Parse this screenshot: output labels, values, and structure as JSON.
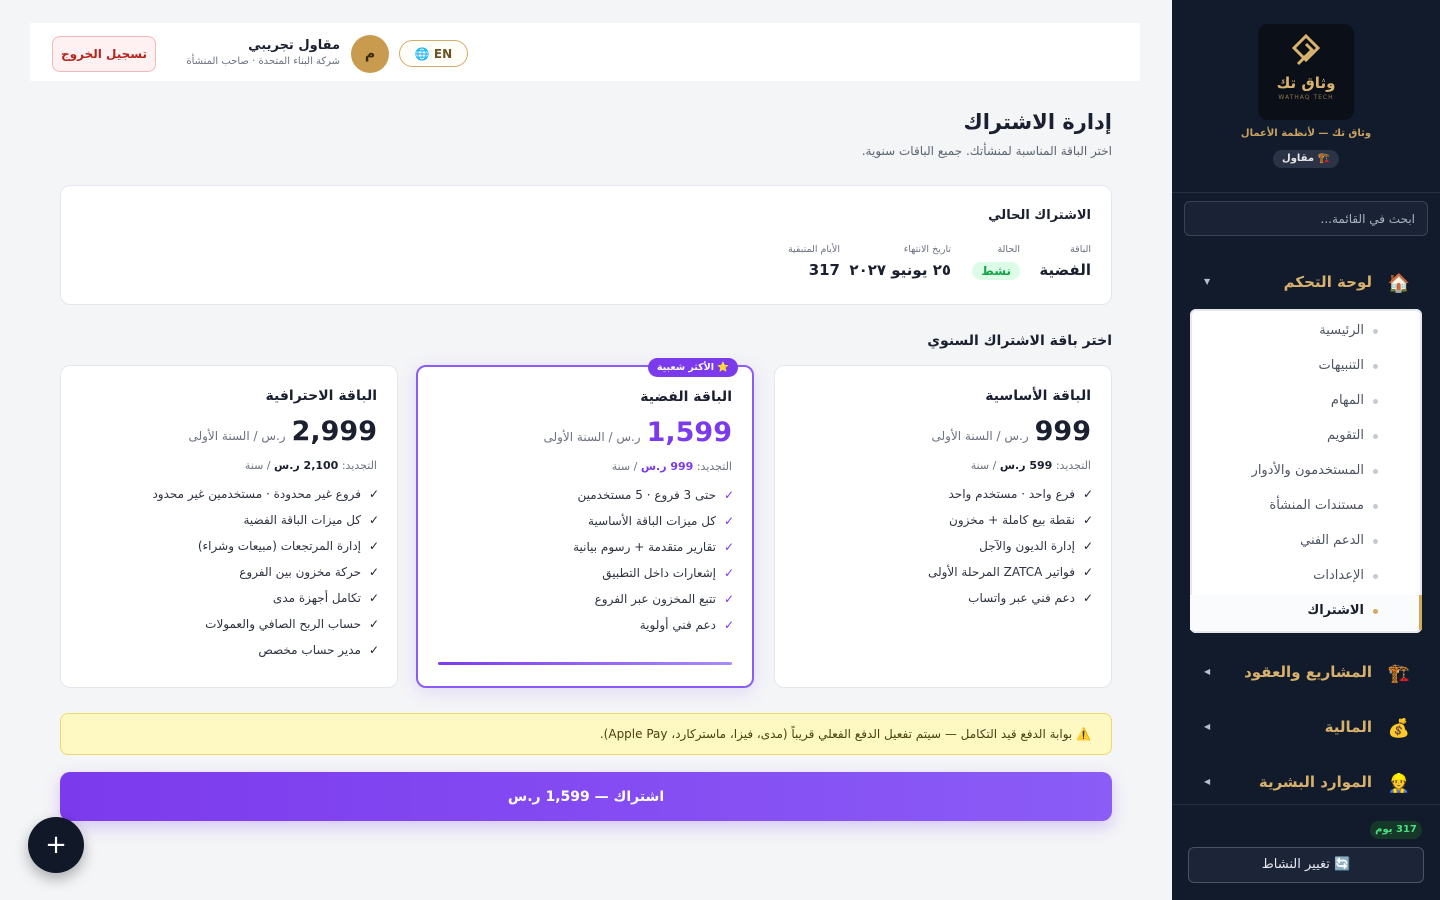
{
  "sidebar": {
    "logo_text": "وثاق تك",
    "logo_sub": "WATHAQ TECH",
    "brand_tagline": "وثاق تك — لأنظمة الأعمال",
    "role_badge": "🏗️ مقاول",
    "search_placeholder": "ابحث في القائمة...",
    "groups": [
      {
        "icon": "🏠",
        "label": "لوحة التحكم",
        "caret": "▼"
      },
      {
        "icon": "🏗️",
        "label": "المشاريع والعقود",
        "caret": "◀"
      },
      {
        "icon": "💰",
        "label": "المالية",
        "caret": "◀"
      },
      {
        "icon": "👷",
        "label": "الموارد البشرية",
        "caret": "◀"
      }
    ],
    "menu_items": [
      "الرئيسية",
      "التنبيهات",
      "المهام",
      "التقويم",
      "المستخدمون والأدوار",
      "مستندات المنشأة",
      "الدعم الفني",
      "الإعدادات",
      "الاشتراك"
    ],
    "days_left_pill": "317 يوم",
    "switch_activity_label": "🔄 تغيير النشاط"
  },
  "topbar": {
    "logout_label": "تسجيل الخروج",
    "user_name": "مقاول تجريبي",
    "user_company": "شركة البناء المتحدة · صاحب المنشأة",
    "avatar_initial": "م",
    "lang_label": "🌐 EN"
  },
  "page": {
    "title": "إدارة الاشتراك",
    "subtitle": "اختر الباقة المناسبة لمنشأتك. جميع الباقات سنوية."
  },
  "current_subscription": {
    "title": "الاشتراك الحالي",
    "plan_label": "الباقة",
    "plan_value": "الفضية",
    "status_label": "الحالة",
    "status_value": "نشط",
    "expiry_label": "تاريخ الانتهاء",
    "expiry_value": "٢٥ يونيو ٢٠٢٧",
    "days_label": "الأيام المتبقية",
    "days_value": "317"
  },
  "plans_title": "اختر باقة الاشتراك السنوي",
  "plans": [
    {
      "name": "الباقة الأساسية",
      "price": "999",
      "unit": "ر.س / السنة الأولى",
      "renew_prefix": "التجديد:",
      "renew_value": "599 ر.س",
      "renew_suffix": "/ سنة",
      "features": [
        "فرع واحد · مستخدم واحد",
        "نقطة بيع كاملة + مخزون",
        "إدارة الديون والآجل",
        "فواتير ZATCA المرحلة الأولى",
        "دعم فني عبر واتساب"
      ]
    },
    {
      "name": "الباقة الفضية",
      "badge": "⭐ الأكثر شعبية",
      "price": "1,599",
      "unit": "ر.س / السنة الأولى",
      "renew_prefix": "التجديد:",
      "renew_value": "999 ر.س",
      "renew_suffix": "/ سنة",
      "features": [
        "حتى 3 فروع · 5 مستخدمين",
        "كل ميزات الباقة الأساسية",
        "تقارير متقدمة + رسوم بيانية",
        "إشعارات داخل التطبيق",
        "تتبع المخزون عبر الفروع",
        "دعم فني أولوية"
      ]
    },
    {
      "name": "الباقة الاحترافية",
      "price": "2,999",
      "unit": "ر.س / السنة الأولى",
      "renew_prefix": "التجديد:",
      "renew_value": "2,100 ر.س",
      "renew_suffix": "/ سنة",
      "features": [
        "فروع غير محدودة · مستخدمين غير محدود",
        "كل ميزات الباقة الفضية",
        "إدارة المرتجعات (مبيعات وشراء)",
        "حركة مخزون بين الفروع",
        "تكامل أجهزة مدى",
        "حساب الربح الصافي والعمولات",
        "مدير حساب مخصص"
      ]
    }
  ],
  "notice": "⚠️ بوابة الدفع قيد التكامل — سيتم تفعيل الدفع الفعلي قريباً (مدى، فيزا، ماستركارد، Apple Pay).",
  "subscribe_label": "اشتراك — 1,599 ر.س",
  "fab_label": "+"
}
